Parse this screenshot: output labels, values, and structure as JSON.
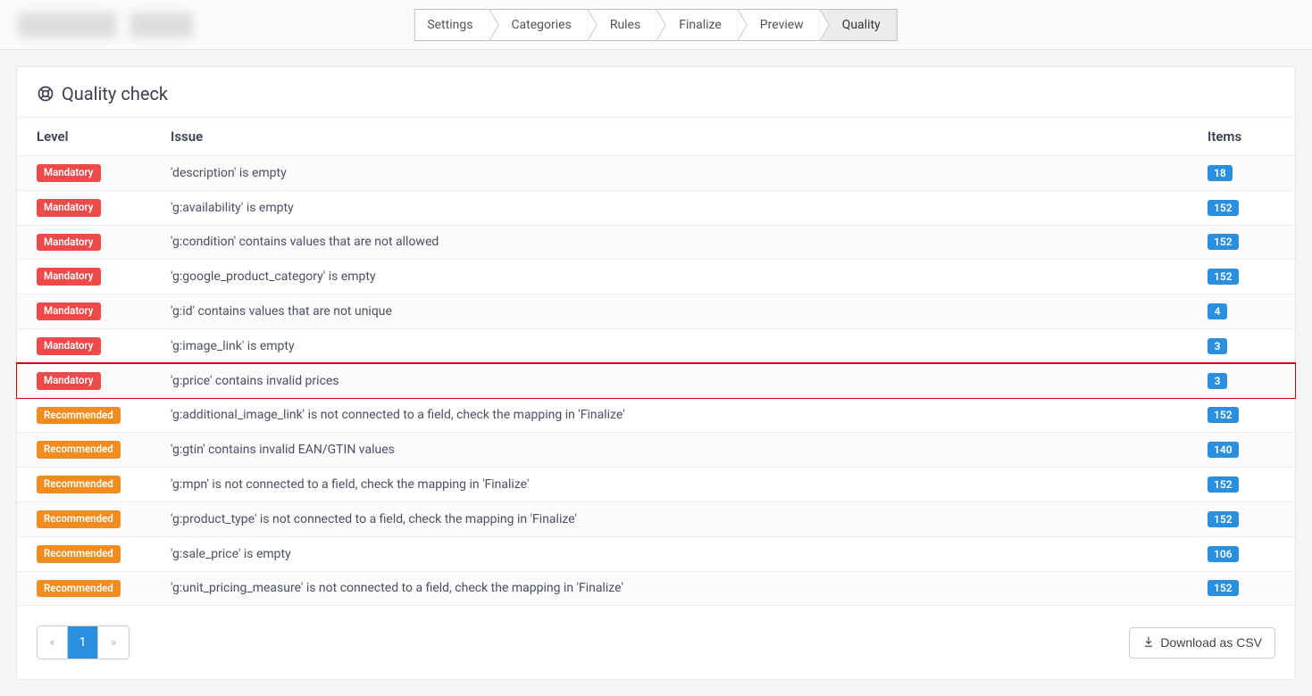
{
  "steps": {
    "items": [
      "Settings",
      "Categories",
      "Rules",
      "Finalize",
      "Preview",
      "Quality"
    ],
    "activeIndex": 5
  },
  "panel": {
    "title": "Quality check"
  },
  "table": {
    "headers": {
      "level": "Level",
      "issue": "Issue",
      "items": "Items"
    },
    "levelLabels": {
      "mandatory": "Mandatory",
      "recommended": "Recommended"
    },
    "rows": [
      {
        "level": "mandatory",
        "issue": "'description' is empty",
        "items": 18,
        "highlight": false
      },
      {
        "level": "mandatory",
        "issue": "'g:availability' is empty",
        "items": 152,
        "highlight": false
      },
      {
        "level": "mandatory",
        "issue": "'g:condition' contains values that are not allowed",
        "items": 152,
        "highlight": false
      },
      {
        "level": "mandatory",
        "issue": "'g:google_product_category' is empty",
        "items": 152,
        "highlight": false
      },
      {
        "level": "mandatory",
        "issue": "'g:id' contains values that are not unique",
        "items": 4,
        "highlight": false
      },
      {
        "level": "mandatory",
        "issue": "'g:image_link' is empty",
        "items": 3,
        "highlight": false
      },
      {
        "level": "mandatory",
        "issue": "'g:price' contains invalid prices",
        "items": 3,
        "highlight": true
      },
      {
        "level": "recommended",
        "issue": "'g:additional_image_link' is not connected to a field, check the mapping in 'Finalize'",
        "items": 152,
        "highlight": false
      },
      {
        "level": "recommended",
        "issue": "'g:gtin' contains invalid EAN/GTIN values",
        "items": 140,
        "highlight": false
      },
      {
        "level": "recommended",
        "issue": "'g:mpn' is not connected to a field, check the mapping in 'Finalize'",
        "items": 152,
        "highlight": false
      },
      {
        "level": "recommended",
        "issue": "'g:product_type' is not connected to a field, check the mapping in 'Finalize'",
        "items": 152,
        "highlight": false
      },
      {
        "level": "recommended",
        "issue": "'g:sale_price' is empty",
        "items": 106,
        "highlight": false
      },
      {
        "level": "recommended",
        "issue": "'g:unit_pricing_measure' is not connected to a field, check the mapping in 'Finalize'",
        "items": 152,
        "highlight": false
      }
    ]
  },
  "pagination": {
    "prev": "«",
    "next": "»",
    "pages": [
      "1"
    ],
    "activeIndex": 0
  },
  "footer": {
    "download": "Download as CSV"
  }
}
